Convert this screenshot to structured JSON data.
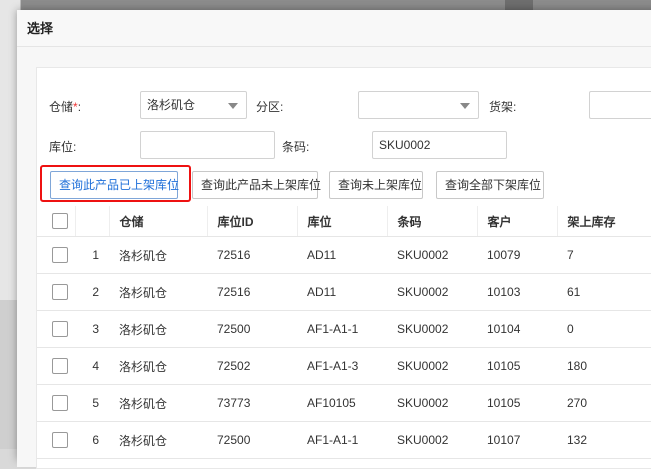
{
  "dialog": {
    "title": "选择"
  },
  "filters": {
    "warehouse_label": "仓储",
    "warehouse_required": "*",
    "warehouse_colon": ":",
    "warehouse_value": "洛杉矶仓",
    "zone_label": "分区:",
    "zone_value": "",
    "shelf_label": "货架:",
    "location_label": "库位:",
    "location_value": "",
    "barcode_label": "条码:",
    "barcode_value": "SKU0002"
  },
  "actions": {
    "query_on_shelf": "查询此产品已上架库位",
    "query_not_on_shelf": "查询此产品未上架库位",
    "query_unshelved": "查询未上架库位",
    "query_all_off_shelf": "查询全部下架库位"
  },
  "table": {
    "columns": [
      "仓储",
      "库位ID",
      "库位",
      "条码",
      "客户",
      "架上库存"
    ],
    "rows": [
      {
        "index": "1",
        "warehouse": "洛杉矶仓",
        "location_id": "72516",
        "location": "AD11",
        "barcode": "SKU0002",
        "customer": "10079",
        "stock": "7"
      },
      {
        "index": "2",
        "warehouse": "洛杉矶仓",
        "location_id": "72516",
        "location": "AD11",
        "barcode": "SKU0002",
        "customer": "10103",
        "stock": "61"
      },
      {
        "index": "3",
        "warehouse": "洛杉矶仓",
        "location_id": "72500",
        "location": "AF1-A1-1",
        "barcode": "SKU0002",
        "customer": "10104",
        "stock": "0"
      },
      {
        "index": "4",
        "warehouse": "洛杉矶仓",
        "location_id": "72502",
        "location": "AF1-A1-3",
        "barcode": "SKU0002",
        "customer": "10105",
        "stock": "180"
      },
      {
        "index": "5",
        "warehouse": "洛杉矶仓",
        "location_id": "73773",
        "location": "AF10105",
        "barcode": "SKU0002",
        "customer": "10105",
        "stock": "270"
      },
      {
        "index": "6",
        "warehouse": "洛杉矶仓",
        "location_id": "72500",
        "location": "AF1-A1-1",
        "barcode": "SKU0002",
        "customer": "10107",
        "stock": "132"
      }
    ]
  },
  "icons": {
    "dropdown": "chevron-down-icon",
    "checkbox": "checkbox-icon"
  }
}
